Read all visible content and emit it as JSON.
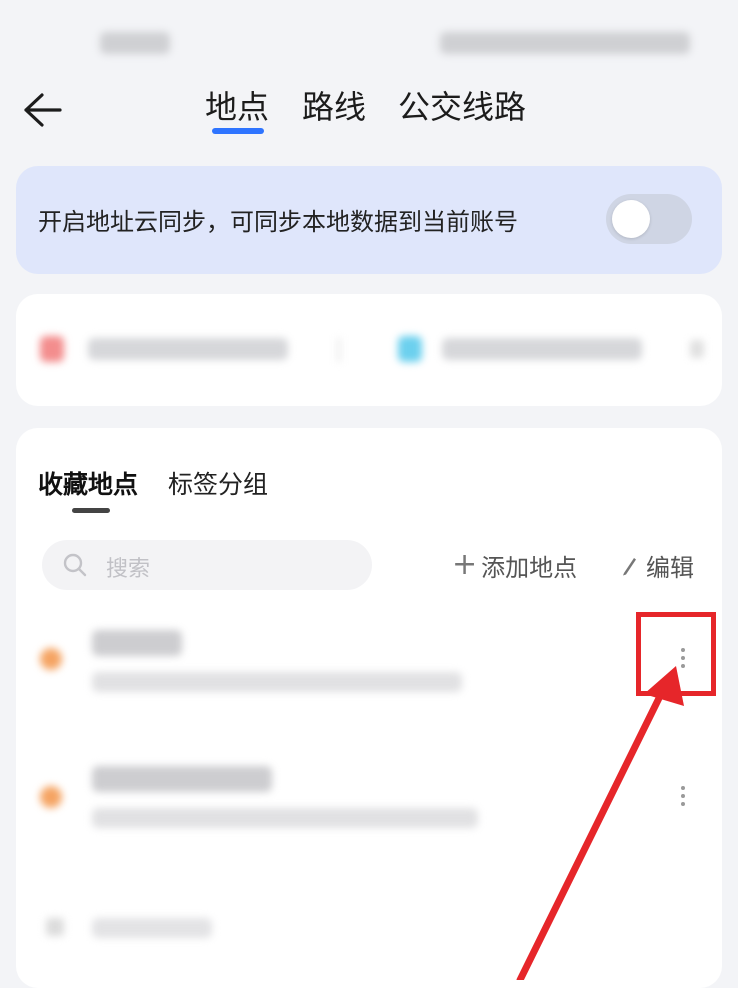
{
  "nav": {
    "tabs": [
      {
        "label": "地点",
        "active": true
      },
      {
        "label": "路线",
        "active": false
      },
      {
        "label": "公交线路",
        "active": false
      }
    ]
  },
  "sync_banner": {
    "text": "开启地址云同步，可同步本地数据到当前账号",
    "toggle_on": false
  },
  "favorites": {
    "subtabs": [
      {
        "label": "收藏地点",
        "active": true
      },
      {
        "label": "标签分组",
        "active": false
      }
    ],
    "search_placeholder": "搜索",
    "add_label": "添加地点",
    "edit_label": "编辑"
  },
  "colors": {
    "accent": "#2e74ff",
    "banner_bg": "#dfe6fb",
    "home_icon": "#f38d8d",
    "work_icon": "#6cd0ee",
    "place_dot": "#f5a463",
    "annotation_red": "#e6262a"
  },
  "icons": [
    "back-arrow-icon",
    "search-icon",
    "plus-icon",
    "pencil-icon",
    "more-vertical-icon"
  ]
}
